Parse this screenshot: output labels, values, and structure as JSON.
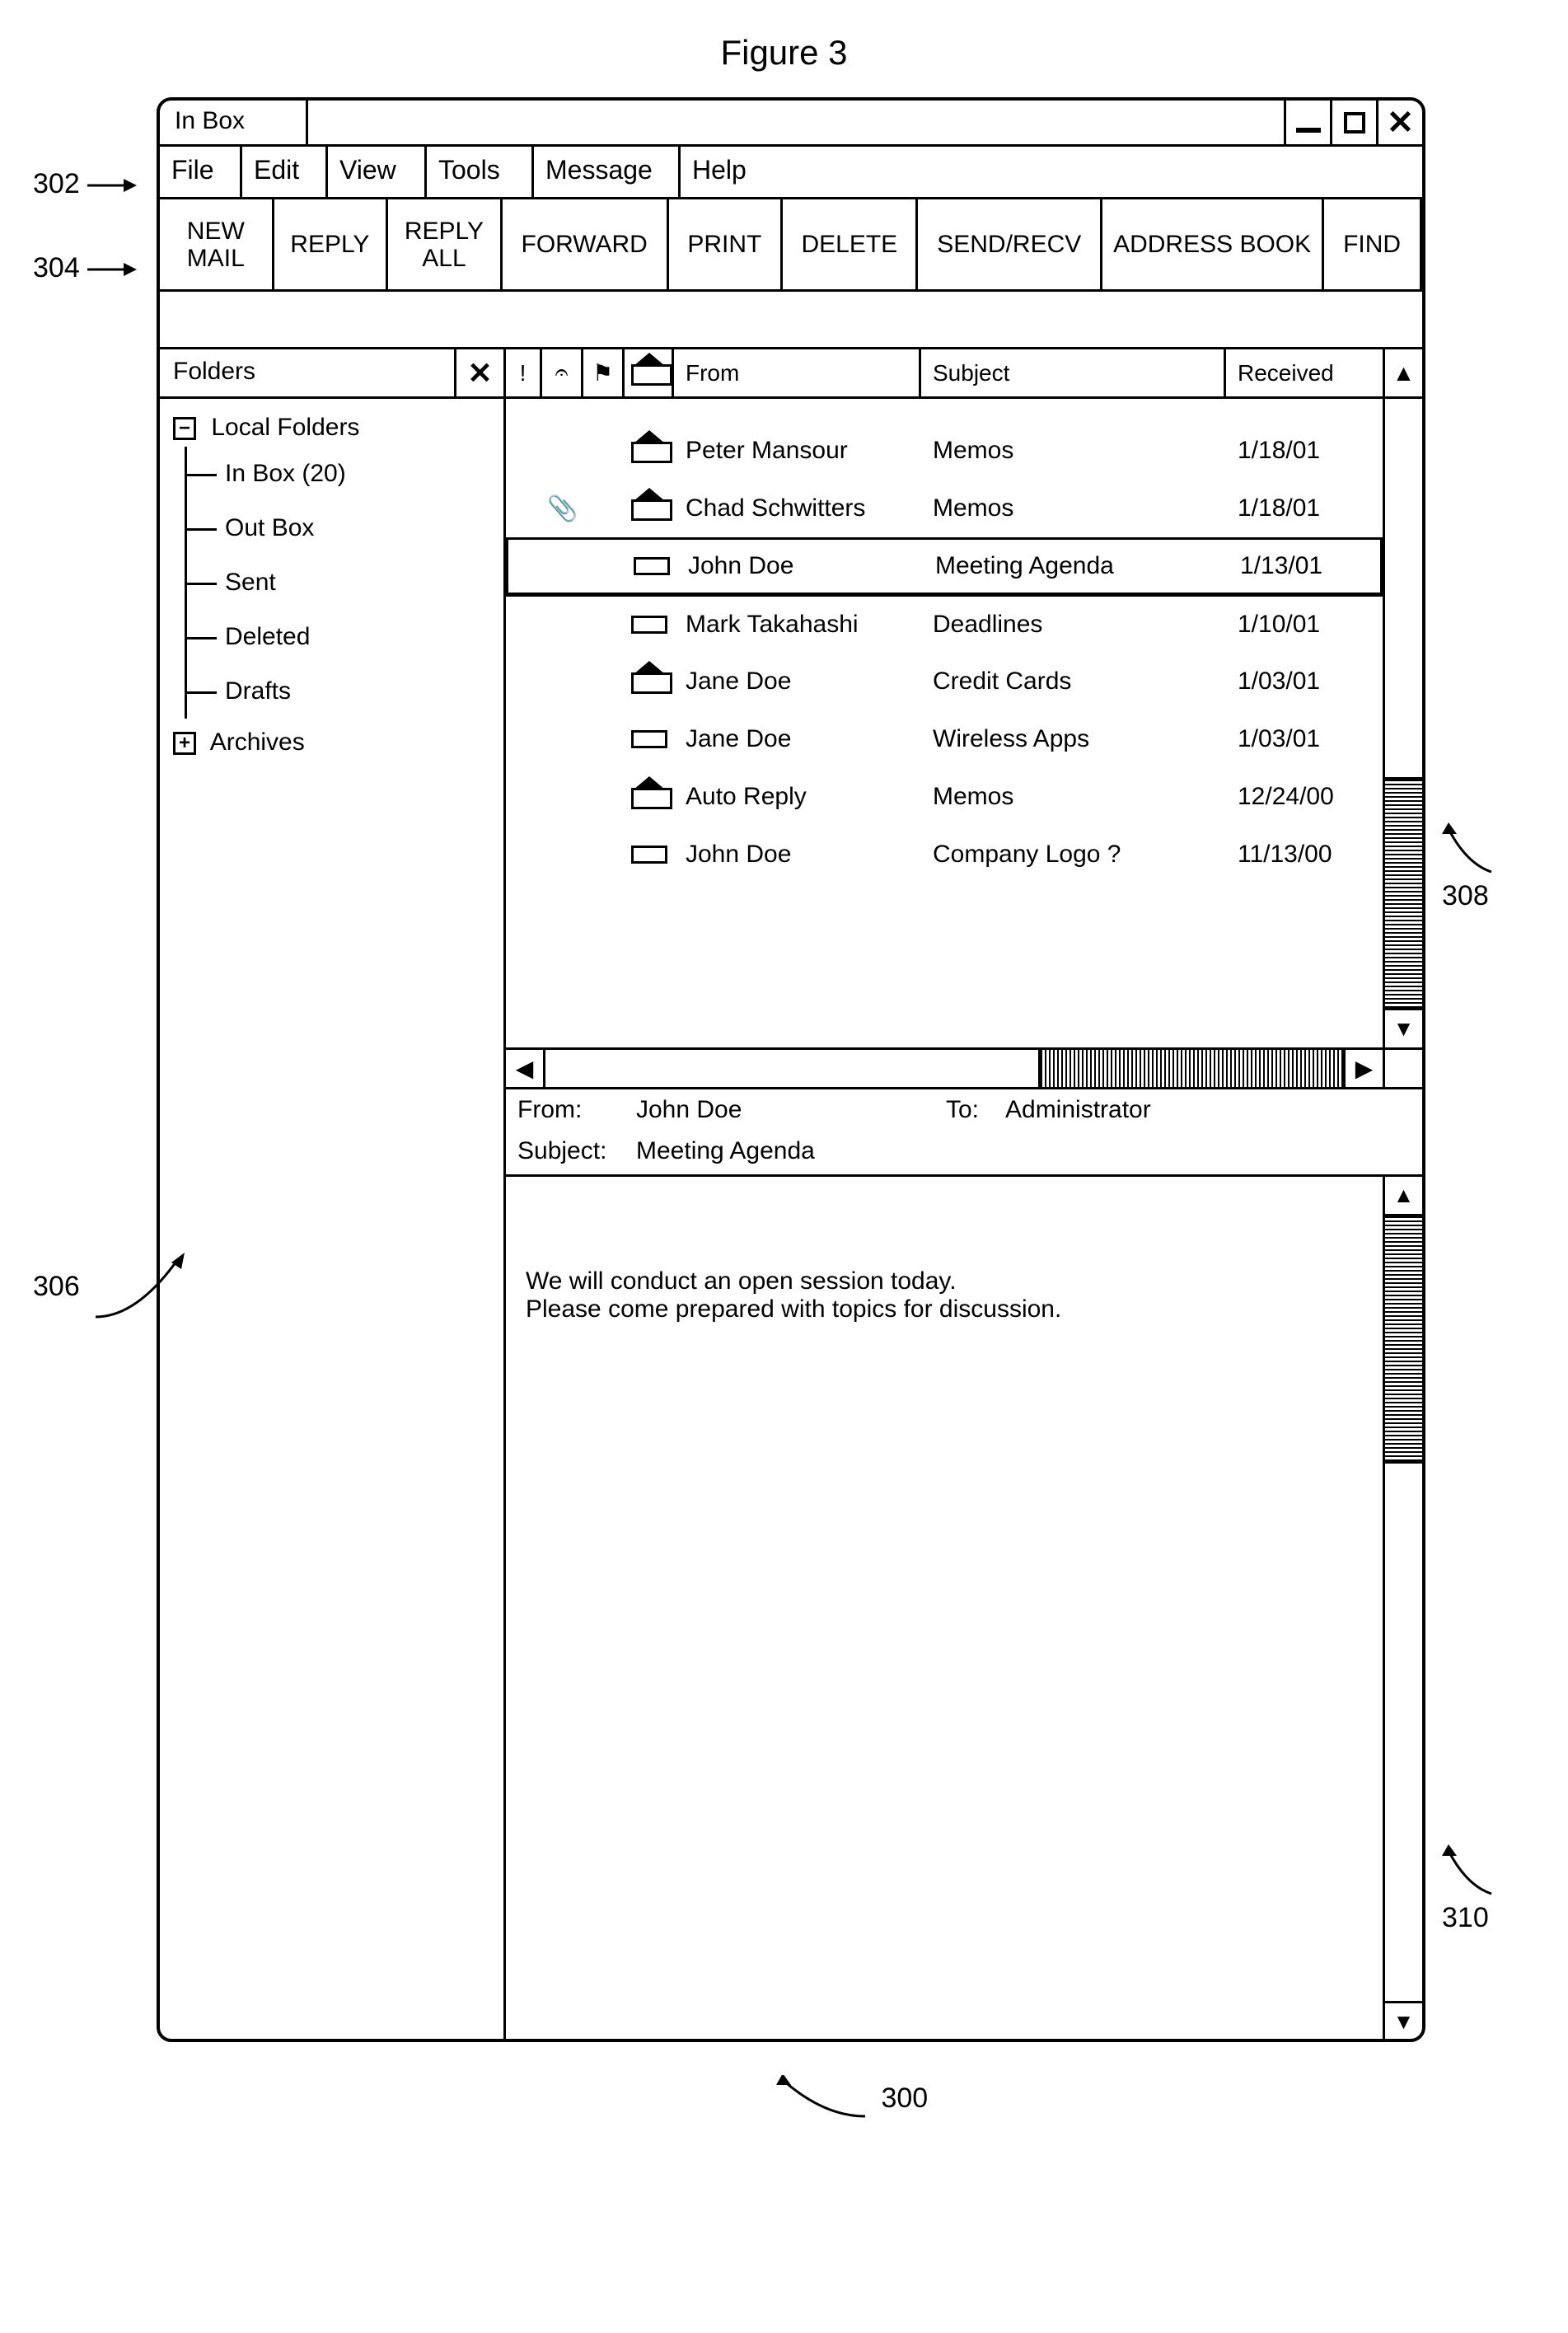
{
  "figure_title": "Figure 3",
  "window": {
    "title": "In Box"
  },
  "menu": {
    "file": "File",
    "edit": "Edit",
    "view": "View",
    "tools": "Tools",
    "message": "Message",
    "help": "Help"
  },
  "toolbar": {
    "newmail": "NEW MAIL",
    "reply": "REPLY",
    "replyall": "REPLY ALL",
    "forward": "FORWARD",
    "print": "PRINT",
    "delete": "DELETE",
    "sendrecv": "SEND/RECV",
    "addrbook": "ADDRESS BOOK",
    "find": "FIND"
  },
  "folders": {
    "header": "Folders",
    "local_label": "Local Folders",
    "children": {
      "inbox": "In Box (20)",
      "outbox": "Out Box",
      "sent": "Sent",
      "deleted": "Deleted",
      "drafts": "Drafts"
    },
    "archives": "Archives"
  },
  "list": {
    "col_from": "From",
    "col_subject": "Subject",
    "col_received": "Received",
    "flag_glyph": "⚑",
    "attach_glyph": "📎",
    "rows": [
      {
        "env": "open",
        "attach": false,
        "from": "Peter Mansour",
        "subject": "Memos",
        "received": "1/18/01"
      },
      {
        "env": "open",
        "attach": true,
        "from": "Chad Schwitters",
        "subject": "Memos",
        "received": "1/18/01"
      },
      {
        "env": "closed",
        "attach": false,
        "from": "John Doe",
        "subject": "Meeting Agenda",
        "received": "1/13/01",
        "selected": true
      },
      {
        "env": "closed",
        "attach": false,
        "from": "Mark Takahashi",
        "subject": "Deadlines",
        "received": "1/10/01"
      },
      {
        "env": "open",
        "attach": false,
        "from": "Jane Doe",
        "subject": "Credit Cards",
        "received": "1/03/01"
      },
      {
        "env": "closed",
        "attach": false,
        "from": "Jane Doe",
        "subject": "Wireless Apps",
        "received": "1/03/01"
      },
      {
        "env": "open",
        "attach": false,
        "from": "Auto Reply",
        "subject": "Memos",
        "received": "12/24/00"
      },
      {
        "env": "closed",
        "attach": false,
        "from": "John Doe",
        "subject": "Company Logo ?",
        "received": "11/13/00"
      }
    ]
  },
  "preview": {
    "from_label": "From:",
    "subject_label": "Subject:",
    "to_label": "To:",
    "from": "John Doe",
    "subject": "Meeting Agenda",
    "to": "Administrator",
    "body_line1": "We will conduct an open session today.",
    "body_line2": "Please come prepared with topics for discussion."
  },
  "callouts": {
    "c300": "300",
    "c302": "302",
    "c304": "304",
    "c306": "306",
    "c308": "308",
    "c310": "310"
  }
}
